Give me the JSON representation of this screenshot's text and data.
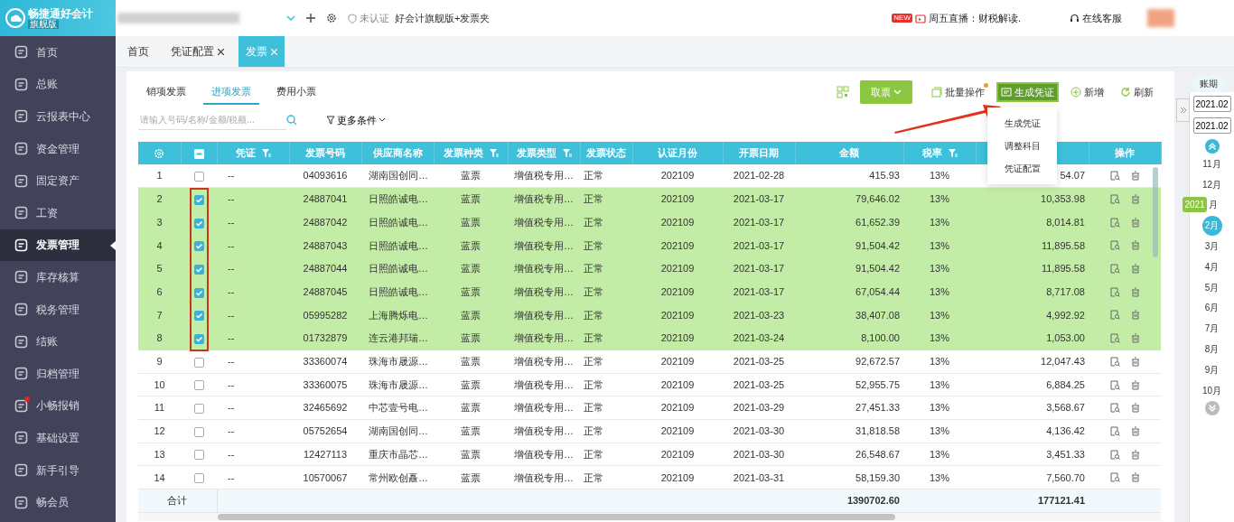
{
  "app": {
    "logo_title": "畅捷通好会计",
    "logo_edition": "旗舰版"
  },
  "top_bar": {
    "status": "未认证",
    "product": "好会计旗舰版+发票夹",
    "live_badge": "NEW",
    "live_text": "周五直播：财税解读.",
    "support": "在线客服"
  },
  "sidebar": {
    "items": [
      {
        "label": "首页",
        "selected": false
      },
      {
        "label": "总账",
        "selected": false
      },
      {
        "label": "云报表中心",
        "selected": false
      },
      {
        "label": "资金管理",
        "selected": false
      },
      {
        "label": "固定资产",
        "selected": false
      },
      {
        "label": "工资",
        "selected": false
      },
      {
        "label": "发票管理",
        "selected": true
      },
      {
        "label": "库存核算",
        "selected": false
      },
      {
        "label": "税务管理",
        "selected": false
      },
      {
        "label": "结账",
        "selected": false
      },
      {
        "label": "归档管理",
        "selected": false
      },
      {
        "label": "小畅报销",
        "selected": false,
        "dot": true
      },
      {
        "label": "基础设置",
        "selected": false
      },
      {
        "label": "新手引导",
        "selected": false
      },
      {
        "label": "畅会员",
        "selected": false
      }
    ]
  },
  "tabs": [
    {
      "label": "首页",
      "closable": false,
      "selected": false
    },
    {
      "label": "凭证配置",
      "closable": true,
      "selected": false
    },
    {
      "label": "发票",
      "closable": true,
      "selected": true
    }
  ],
  "sub_tabs": [
    {
      "label": "销项发票",
      "selected": false
    },
    {
      "label": "进项发票",
      "selected": true
    },
    {
      "label": "费用小票",
      "selected": false
    }
  ],
  "search": {
    "placeholder": "请输入号码/名称/金额/税额...",
    "filter_label": "更多条件"
  },
  "toolbar": [
    {
      "kind": "qr"
    },
    {
      "kind": "dropdown",
      "label": "取票"
    },
    {
      "kind": "batch",
      "label": "批量操作",
      "dot": true
    },
    {
      "kind": "voucher",
      "label": "生成凭证",
      "active": true
    },
    {
      "kind": "add",
      "label": "新增"
    },
    {
      "kind": "refresh",
      "label": "刷新"
    }
  ],
  "dropdown_menu": {
    "items": [
      "生成凭证",
      "调整科目",
      "凭证配置"
    ]
  },
  "table": {
    "columns": [
      {
        "kind": "settings"
      },
      {
        "kind": "select",
        "indeterminate": true
      },
      {
        "kind": "text",
        "label": "凭证",
        "filter": true
      },
      {
        "kind": "text",
        "label": "发票号码",
        "filter": false
      },
      {
        "kind": "text",
        "label": "供应商名称",
        "filter": false
      },
      {
        "kind": "text",
        "label": "发票种类",
        "filter": true
      },
      {
        "kind": "text",
        "label": "发票类型",
        "filter": true
      },
      {
        "kind": "text",
        "label": "发票状态",
        "filter": false
      },
      {
        "kind": "text",
        "label": "认证月份",
        "filter": false
      },
      {
        "kind": "text",
        "label": "开票日期",
        "filter": false
      },
      {
        "kind": "amount",
        "label": "金额",
        "filter": false
      },
      {
        "kind": "text",
        "label": "税率",
        "filter": true
      },
      {
        "kind": "amount"
      },
      {
        "kind": "actions",
        "label": "操作",
        "filter": false
      }
    ],
    "rows": [
      {
        "selected": false,
        "cells": [
          "1",
          "",
          "--",
          "04093616",
          "湖南国创同…",
          "蓝票",
          "增值税专用…",
          "正常",
          "202109",
          "2021-02-28",
          "415.93",
          "13%",
          "54.07"
        ]
      },
      {
        "selected": true,
        "cells": [
          "2",
          "",
          "--",
          "24887041",
          "日照皓诚电…",
          "蓝票",
          "增值税专用…",
          "正常",
          "202109",
          "2021-03-17",
          "79,646.02",
          "13%",
          "10,353.98"
        ]
      },
      {
        "selected": true,
        "cells": [
          "3",
          "",
          "--",
          "24887042",
          "日照皓诚电…",
          "蓝票",
          "增值税专用…",
          "正常",
          "202109",
          "2021-03-17",
          "61,652.39",
          "13%",
          "8,014.81"
        ]
      },
      {
        "selected": true,
        "cells": [
          "4",
          "",
          "--",
          "24887043",
          "日照皓诚电…",
          "蓝票",
          "增值税专用…",
          "正常",
          "202109",
          "2021-03-17",
          "91,504.42",
          "13%",
          "11,895.58"
        ]
      },
      {
        "selected": true,
        "cells": [
          "5",
          "",
          "--",
          "24887044",
          "日照皓诚电…",
          "蓝票",
          "增值税专用…",
          "正常",
          "202109",
          "2021-03-17",
          "91,504.42",
          "13%",
          "11,895.58"
        ]
      },
      {
        "selected": true,
        "cells": [
          "6",
          "",
          "--",
          "24887045",
          "日照皓诚电…",
          "蓝票",
          "增值税专用…",
          "正常",
          "202109",
          "2021-03-17",
          "67,054.44",
          "13%",
          "8,717.08"
        ]
      },
      {
        "selected": true,
        "cells": [
          "7",
          "",
          "--",
          "05995282",
          "上海腾烁电…",
          "蓝票",
          "增值税专用…",
          "正常",
          "202109",
          "2021-03-23",
          "38,407.08",
          "13%",
          "4,992.92"
        ]
      },
      {
        "selected": true,
        "cells": [
          "8",
          "",
          "--",
          "01732879",
          "连云港邦瑞…",
          "蓝票",
          "增值税专用…",
          "正常",
          "202109",
          "2021-03-24",
          "8,100.00",
          "13%",
          "1,053.00"
        ]
      },
      {
        "selected": false,
        "cells": [
          "9",
          "",
          "--",
          "33360074",
          "珠海市晟源…",
          "蓝票",
          "增值税专用…",
          "正常",
          "202109",
          "2021-03-25",
          "92,672.57",
          "13%",
          "12,047.43"
        ]
      },
      {
        "selected": false,
        "cells": [
          "10",
          "",
          "--",
          "33360075",
          "珠海市晟源…",
          "蓝票",
          "增值税专用…",
          "正常",
          "202109",
          "2021-03-25",
          "52,955.75",
          "13%",
          "6,884.25"
        ]
      },
      {
        "selected": false,
        "cells": [
          "11",
          "",
          "--",
          "32465692",
          "中芯壹号电…",
          "蓝票",
          "增值税专用…",
          "正常",
          "202109",
          "2021-03-29",
          "27,451.33",
          "13%",
          "3,568.67"
        ]
      },
      {
        "selected": false,
        "cells": [
          "12",
          "",
          "--",
          "05752654",
          "湖南国创同…",
          "蓝票",
          "增值税专用…",
          "正常",
          "202109",
          "2021-03-30",
          "31,818.58",
          "13%",
          "4,136.42"
        ]
      },
      {
        "selected": false,
        "cells": [
          "13",
          "",
          "--",
          "12427113",
          "重庆市晶芯…",
          "蓝票",
          "增值税专用…",
          "正常",
          "202109",
          "2021-03-30",
          "26,548.67",
          "13%",
          "3,451.33"
        ]
      },
      {
        "selected": false,
        "cells": [
          "14",
          "",
          "--",
          "10570067",
          "常州欧创矗…",
          "蓝票",
          "增值税专用…",
          "正常",
          "202109",
          "2021-03-31",
          "58,159.30",
          "13%",
          "7,560.70"
        ]
      }
    ],
    "totals": {
      "label": "合计",
      "values": [
        "1390702.60",
        "177121.41"
      ]
    }
  },
  "period_panel": {
    "label": "账期",
    "from": "2021.02",
    "to": "2021.02",
    "months": [
      {
        "label": "11月",
        "selected": false
      },
      {
        "label": "12月",
        "selected": false
      },
      {
        "label": "月",
        "selected": false,
        "year_badge": "2021"
      },
      {
        "label": "2月",
        "selected": true
      },
      {
        "label": "3月",
        "selected": false
      },
      {
        "label": "4月",
        "selected": false
      },
      {
        "label": "5月",
        "selected": false
      },
      {
        "label": "6月",
        "selected": false
      },
      {
        "label": "7月",
        "selected": false
      },
      {
        "label": "8月",
        "selected": false
      },
      {
        "label": "9月",
        "selected": false
      },
      {
        "label": "10月",
        "selected": false
      }
    ]
  }
}
